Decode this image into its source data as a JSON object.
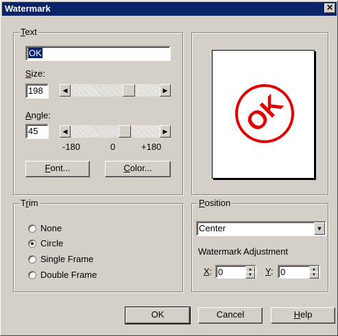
{
  "window": {
    "title": "Watermark",
    "close_icon": "✕"
  },
  "text_group": {
    "label_prefix": "",
    "label_mnemonic": "T",
    "label_rest": "ext",
    "text_value": "OK",
    "size": {
      "label_mnemonic": "S",
      "label_rest": "ize:",
      "value": "198",
      "slider_fraction": 0.68
    },
    "angle": {
      "label_mnemonic": "A",
      "label_rest": "ngle:",
      "value": "45",
      "slider_fraction": 0.625,
      "scale_min": "-180",
      "scale_mid": "0",
      "scale_max": "+180"
    },
    "font_button": {
      "mnemonic": "F",
      "rest": "ont..."
    },
    "color_button": {
      "mnemonic": "C",
      "rest": "olor..."
    }
  },
  "preview": {
    "stamp_text": "OK",
    "stamp_color": "#e00000",
    "rotation_deg": -45
  },
  "trim_group": {
    "label_prefix": "T",
    "label_mnemonic": "r",
    "label_rest": "im",
    "options": [
      {
        "label": "None",
        "selected": false
      },
      {
        "label": "Circle",
        "selected": true
      },
      {
        "label": "Single Frame",
        "selected": false
      },
      {
        "label": "Double Frame",
        "selected": false
      }
    ]
  },
  "position_group": {
    "label_mnemonic": "P",
    "label_rest": "osition",
    "selected": "Center",
    "adjustment_label": "Watermark Adjustment",
    "x_label_mnemonic": "X",
    "x_value": "0",
    "y_label_mnemonic": "Y",
    "y_value": "0"
  },
  "buttons": {
    "ok": "OK",
    "cancel": "Cancel",
    "help_mnemonic": "H",
    "help_rest": "elp"
  },
  "icons": {
    "left_arrow": "◀",
    "right_arrow": "▶",
    "down_arrow": "▼",
    "up_small": "▲",
    "down_small": "▼"
  }
}
